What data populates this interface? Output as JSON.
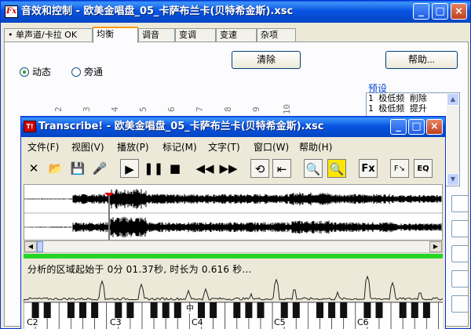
{
  "back_window": {
    "title": "音效和控制 - 欧美金唱盘_05_卡萨布兰卡(贝特希金斯).xsc",
    "controls": {
      "minimize": "_",
      "maximize": "□",
      "close": "×"
    },
    "tabs": [
      {
        "label": "• 单声道/卡拉 OK"
      },
      {
        "label": "均衡"
      },
      {
        "label": "调音"
      },
      {
        "label": "变调"
      },
      {
        "label": "变速"
      },
      {
        "label": "杂项"
      }
    ],
    "active_tab": "均衡",
    "radios": [
      {
        "label": "动态",
        "selected": true
      },
      {
        "label": "旁通",
        "selected": false
      }
    ],
    "clear_button": "清除",
    "help_button": "帮助...",
    "preset_label": "预设",
    "presets": [
      "1 极低频 削除",
      "1 极低频 提升"
    ],
    "eq_band_numbers": [
      "2",
      "3",
      "4",
      "5",
      "6",
      "7",
      "8",
      "9",
      "10"
    ]
  },
  "front_window": {
    "title": "Transcribe! - 欧美金唱盘_05_卡萨布兰卡(贝特希金斯).xsc",
    "icon_text": "T!",
    "controls": {
      "minimize": "_",
      "maximize": "□",
      "close": "×"
    },
    "menu": [
      "文件(F)",
      "视图(V)",
      "播放(P)",
      "标记(M)",
      "文字(T)",
      "窗口(W)",
      "帮助(H)"
    ],
    "status_text": "分析的区域起始于 0分 01.37秒, 时长为 0.616 秒...",
    "octave_labels": [
      "C2",
      "C3",
      "C4",
      "C5",
      "C6"
    ],
    "middle_c_label": "中",
    "fx_button": "Fx",
    "fx_eq_label": "EQ"
  },
  "colors": {
    "titlebar": "#0a5de2",
    "waveform": "#000000",
    "progress": "#26d526",
    "marker": "#e00000"
  }
}
